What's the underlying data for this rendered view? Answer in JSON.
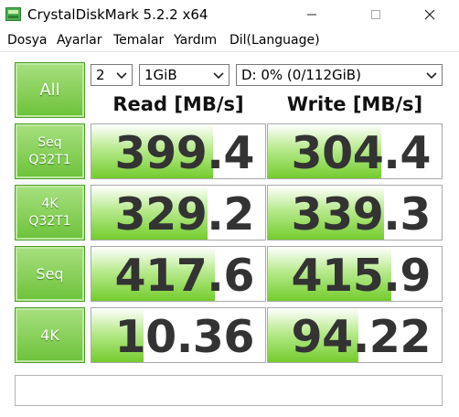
{
  "window": {
    "title": "CrystalDiskMark 5.2.2 x64"
  },
  "menu": [
    "Dosya",
    "Ayarlar",
    "Temalar",
    "Yardım",
    "Dil(Language)"
  ],
  "controls": {
    "count": "2",
    "size": "1GiB",
    "drive": "D: 0% (0/112GiB)"
  },
  "headers": {
    "read": "Read [MB/s]",
    "write": "Write [MB/s]"
  },
  "buttons": {
    "all": "All",
    "seq_q32t1": "Seq\nQ32T1",
    "k4_q32t1": "4K\nQ32T1",
    "seq": "Seq",
    "k4": "4K"
  },
  "results": {
    "seq_q32t1": {
      "read": "399.4",
      "write": "304.4",
      "read_fill": 0.7,
      "write_fill": 0.65
    },
    "k4_q32t1": {
      "read": "329.2",
      "write": "339.3",
      "read_fill": 0.67,
      "write_fill": 0.67
    },
    "seq": {
      "read": "417.6",
      "write": "415.9",
      "read_fill": 0.71,
      "write_fill": 0.71
    },
    "k4": {
      "read": "10.36",
      "write": "94.22",
      "read_fill": 0.3,
      "write_fill": 0.52
    }
  },
  "status_text": "",
  "colors": {
    "accent_green": "#6cc23a",
    "bar_green": "#74cc2e"
  }
}
